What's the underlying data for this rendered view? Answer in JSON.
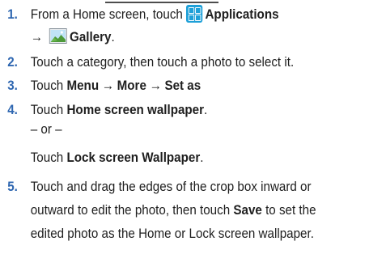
{
  "steps": [
    {
      "number": "1.",
      "line1": {
        "text": "From a Home screen, touch",
        "applications_label": "Applications"
      },
      "line2": {
        "arrow": "→",
        "gallery_label": "Gallery",
        "period": "."
      }
    },
    {
      "number": "2.",
      "text": "Touch a category, then touch a photo to select it."
    },
    {
      "number": "3.",
      "prefix": "Touch",
      "menu": "Menu",
      "arrow1": "→",
      "more": "More",
      "arrow2": "→",
      "set_as": "Set as"
    },
    {
      "number": "4.",
      "prefix": "Touch",
      "home_wallpaper": "Home screen wallpaper",
      "period": ".",
      "or_text": "– or –",
      "prefix2": "Touch",
      "lock_wallpaper": "Lock screen Wallpaper",
      "period2": "."
    },
    {
      "number": "5.",
      "line1": "Touch and drag the edges of the crop box inward or",
      "line2_a": "outward to edit the photo, then touch",
      "save": "Save",
      "line2_b": "to set the",
      "line3": "edited photo as the Home or Lock screen wallpaper."
    }
  ],
  "colors": {
    "step_number": "#2f67b1",
    "apps_icon": "#1ea0d8",
    "text": "#1e1e1e"
  },
  "icons": {
    "applications": "applications-grid-icon",
    "gallery": "gallery-landscape-icon"
  }
}
